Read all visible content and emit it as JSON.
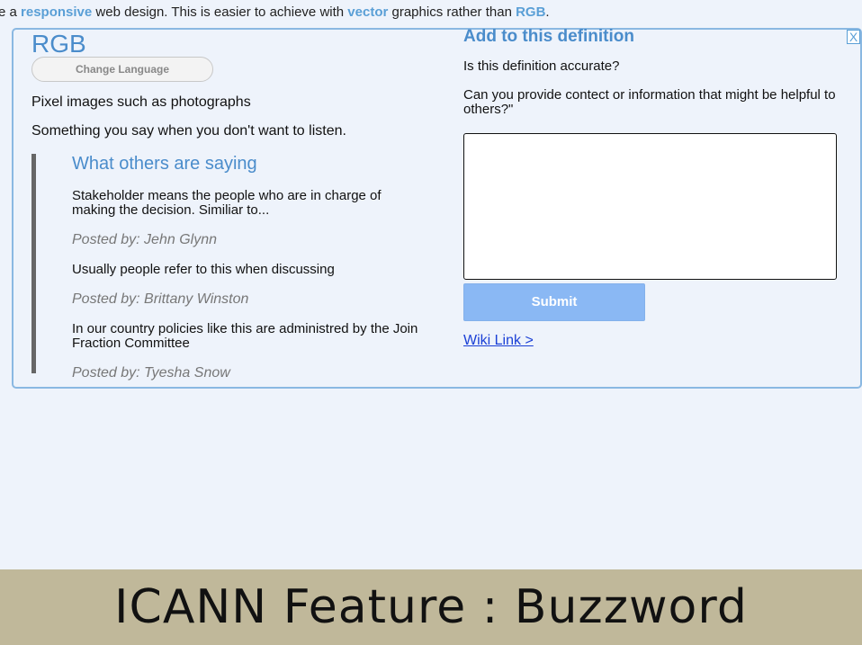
{
  "intro": {
    "prefix": "e a ",
    "responsive": "responsive",
    "mid1": " web design. This is easier to achieve with ",
    "vector": "vector",
    "mid2": " graphics rather than ",
    "rgb": "RGB",
    "suffix": "."
  },
  "card": {
    "term": "RGB",
    "change_language": "Change Language",
    "close_label": "X",
    "definitions": [
      "Pixel images such as photographs",
      "Something you say when you don't want to listen."
    ],
    "others": {
      "heading": "What others are saying",
      "comments": [
        {
          "text": "Stakeholder means the people who are in charge of making the decision. Similiar to...",
          "posted": "Posted by: Jehn Glynn"
        },
        {
          "text": "Usually people refer to this when discussing",
          "posted": "Posted by: Brittany Winston"
        },
        {
          "text": "In our country policies like this are administred by the Join Fraction Committee",
          "posted": "Posted by: Tyesha Snow"
        }
      ]
    },
    "add": {
      "heading": "Add to this definition",
      "question1": "Is this definition accurate?",
      "question2": "Can you provide contect or information that might be helpful to others?\"",
      "textarea_value": "",
      "submit": "Submit",
      "wiki_link": "Wiki Link >"
    }
  },
  "footer": {
    "title": "ICANN Feature : Buzzword"
  }
}
